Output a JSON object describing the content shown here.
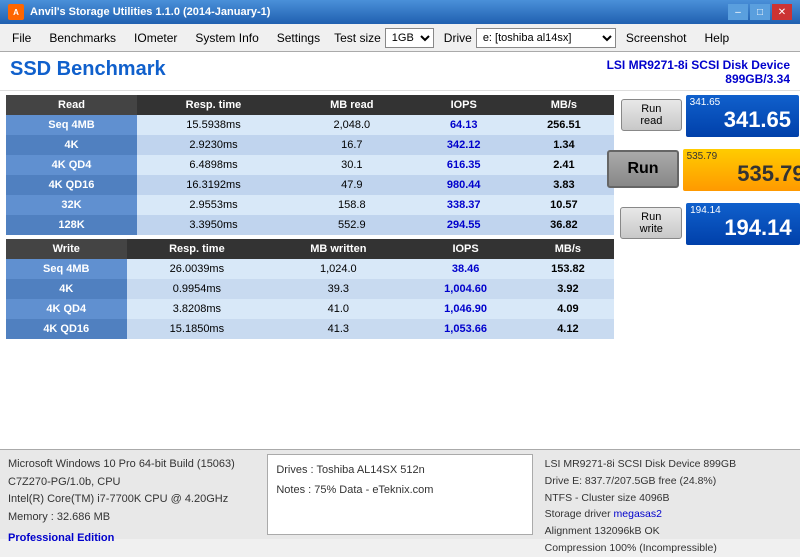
{
  "window": {
    "title": "Anvil's Storage Utilities 1.1.0 (2014-January-1)"
  },
  "menu": {
    "file": "File",
    "benchmarks": "Benchmarks",
    "iometer": "IOmeter",
    "system_info": "System Info",
    "settings": "Settings",
    "test_size_label": "Test size",
    "test_size_value": "1GB",
    "drive_label": "Drive",
    "drive_value": "e: [toshiba al14sx]",
    "screenshot": "Screenshot",
    "help": "Help"
  },
  "header": {
    "title": "SSD Benchmark",
    "device_line1": "LSI MR9271-8i SCSI Disk Device",
    "device_line2": "899GB/3.34"
  },
  "table_headers": {
    "read": "Read",
    "write": "Write",
    "resp_time": "Resp. time",
    "mb_read": "MB read",
    "mb_written": "MB written",
    "iops": "IOPS",
    "mbs": "MB/s"
  },
  "read_rows": [
    {
      "label": "Seq 4MB",
      "resp": "15.5938ms",
      "mb": "2,048.0",
      "iops": "64.13",
      "mbs": "256.51"
    },
    {
      "label": "4K",
      "resp": "2.9230ms",
      "mb": "16.7",
      "iops": "342.12",
      "mbs": "1.34"
    },
    {
      "label": "4K QD4",
      "resp": "6.4898ms",
      "mb": "30.1",
      "iops": "616.35",
      "mbs": "2.41"
    },
    {
      "label": "4K QD16",
      "resp": "16.3192ms",
      "mb": "47.9",
      "iops": "980.44",
      "mbs": "3.83"
    },
    {
      "label": "32K",
      "resp": "2.9553ms",
      "mb": "158.8",
      "iops": "338.37",
      "mbs": "10.57"
    },
    {
      "label": "128K",
      "resp": "3.3950ms",
      "mb": "552.9",
      "iops": "294.55",
      "mbs": "36.82"
    }
  ],
  "write_rows": [
    {
      "label": "Seq 4MB",
      "resp": "26.0039ms",
      "mb": "1,024.0",
      "iops": "38.46",
      "mbs": "153.82"
    },
    {
      "label": "4K",
      "resp": "0.9954ms",
      "mb": "39.3",
      "iops": "1,004.60",
      "mbs": "3.92"
    },
    {
      "label": "4K QD4",
      "resp": "3.8208ms",
      "mb": "41.0",
      "iops": "1,046.90",
      "mbs": "4.09"
    },
    {
      "label": "4K QD16",
      "resp": "15.1850ms",
      "mb": "41.3",
      "iops": "1,053.66",
      "mbs": "4.12"
    }
  ],
  "scores": {
    "read_label": "341.65",
    "read_value": "341.65",
    "run_label": "535.79",
    "run_value": "535.79",
    "write_label": "194.14",
    "write_value": "194.14"
  },
  "buttons": {
    "run_read": "Run read",
    "run": "Run",
    "run_write": "Run write"
  },
  "status": {
    "os": "Microsoft Windows 10 Pro 64-bit Build (15063)",
    "cpu_model": "C7Z270-PG/1.0b, CPU",
    "cpu_detail": "Intel(R) Core(TM) i7-7700K CPU @ 4.20GHz",
    "memory": "Memory : 32.686 MB",
    "pro_edition": "Professional Edition",
    "drives_label": "Drives : Toshiba AL14SX 512n",
    "notes_label": "Notes : 75% Data - eTeknix.com",
    "device_right": "LSI MR9271-8i SCSI Disk Device 899GB",
    "drive_e": "Drive E: 837.7/207.5GB free (24.8%)",
    "ntfs": "NTFS - Cluster size 4096B",
    "storage_driver_label": "Storage driver",
    "storage_driver_value": "megasas2",
    "alignment": "Alignment 132096kB OK",
    "compression": "Compression 100% (Incompressible)"
  }
}
